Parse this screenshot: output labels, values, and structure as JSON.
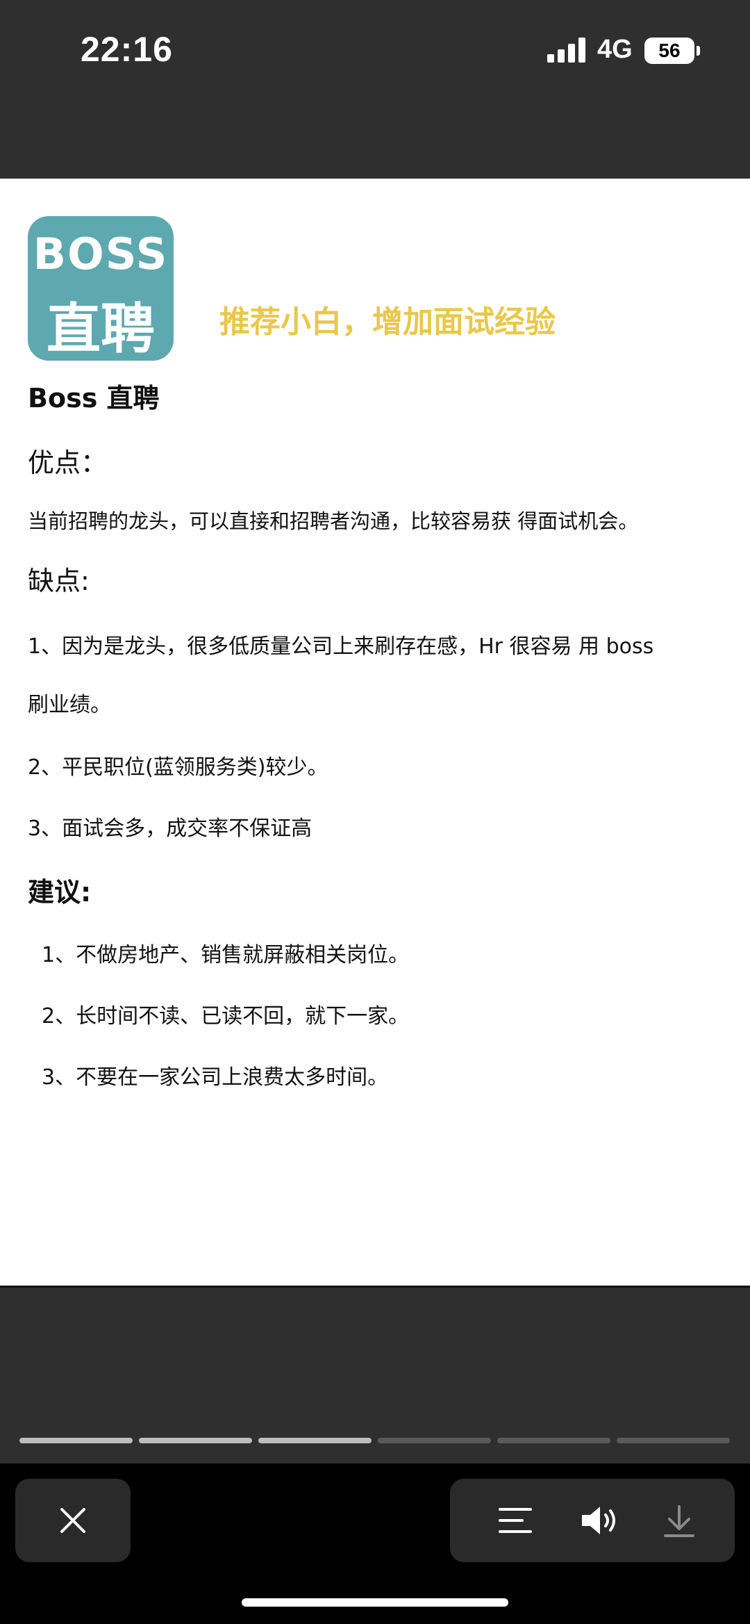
{
  "status_bar": {
    "time": "22:16",
    "network": "4G",
    "battery": "56",
    "signal_icon": "cellular-signal-icon",
    "battery_icon": "battery-icon"
  },
  "document": {
    "logo": {
      "line1": "BOSS",
      "line2": "直聘",
      "color": "#5ea8b0"
    },
    "tagline": "推荐小白，增加面试经验",
    "tagline_color": "#e8c84a",
    "title": "Boss 直聘",
    "pros_heading": "优点：",
    "pros_text": "当前招聘的龙头，可以直接和招聘者沟通，比较容易获 得面试机会。",
    "cons_heading": "缺点:",
    "cons": [
      "1、因为是龙头，很多低质量公司上来刷存在感，Hr 很容易 用 boss",
      "刷业绩。",
      "2、平民职位(蓝领服务类)较少。",
      "3、面试会多，成交率不保证高"
    ],
    "advice_heading": "建议:",
    "advice": [
      "1、不做房地产、销售就屏蔽相关岗位。",
      "2、长时间不读、已读不回，就下一家。",
      "3、不要在一家公司上浪费太多时间。"
    ]
  },
  "viewer": {
    "progress": {
      "total": 6,
      "current": 3,
      "active_color": "#bdbdbd",
      "inactive_color": "#5a5a5a"
    },
    "buttons": {
      "close_icon": "close-icon",
      "menu_icon": "menu-lines-icon",
      "sound_icon": "speaker-icon",
      "download_icon": "download-icon"
    }
  }
}
